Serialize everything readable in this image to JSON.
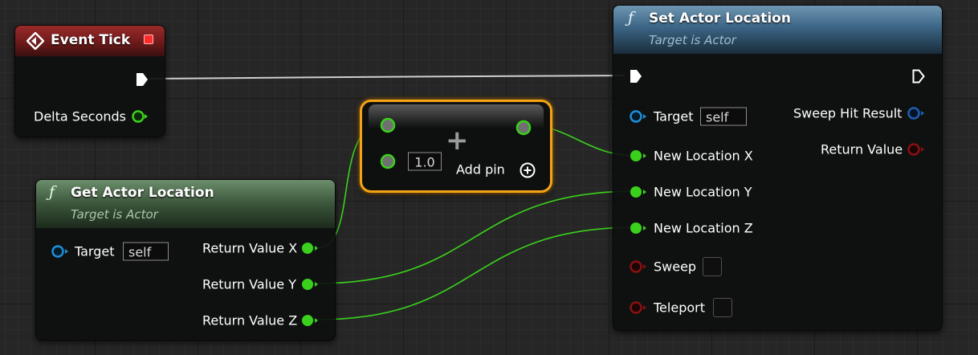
{
  "event_tick": {
    "title": "Event Tick",
    "pins": {
      "delta_seconds": "Delta Seconds"
    }
  },
  "get_actor_location": {
    "title": "Get Actor Location",
    "subtitle": "Target is Actor",
    "pins": {
      "target": "Target",
      "target_value": "self",
      "return_x": "Return Value X",
      "return_y": "Return Value Y",
      "return_z": "Return Value Z"
    }
  },
  "add_node": {
    "symbol": "+",
    "input_value": "1.0",
    "add_pin_label": "Add pin"
  },
  "set_actor_location": {
    "title": "Set Actor Location",
    "subtitle": "Target is Actor",
    "pins": {
      "target": "Target",
      "target_value": "self",
      "new_x": "New Location X",
      "new_y": "New Location Y",
      "new_z": "New Location Z",
      "sweep": "Sweep",
      "teleport": "Teleport",
      "sweep_hit_result": "Sweep Hit Result",
      "return_value": "Return Value"
    },
    "checkboxes": {
      "sweep_checked": false,
      "teleport_checked": false
    }
  },
  "colors": {
    "event_header": "#7a1f1f",
    "function_header": "#4d6e4d",
    "set_header": "#3f6780",
    "float_pin": "#3ad11c",
    "object_pin": "#1c8fd9",
    "struct_pin": "#1f5fb0",
    "bool_pin": "#8a1010",
    "exec_pin": "#ffffff",
    "selection": "#f5a316"
  },
  "icons": {
    "event": "diamond-event-icon",
    "function": "function-f-icon",
    "add_pin": "circle-plus-icon",
    "stop": "red-square-icon"
  }
}
